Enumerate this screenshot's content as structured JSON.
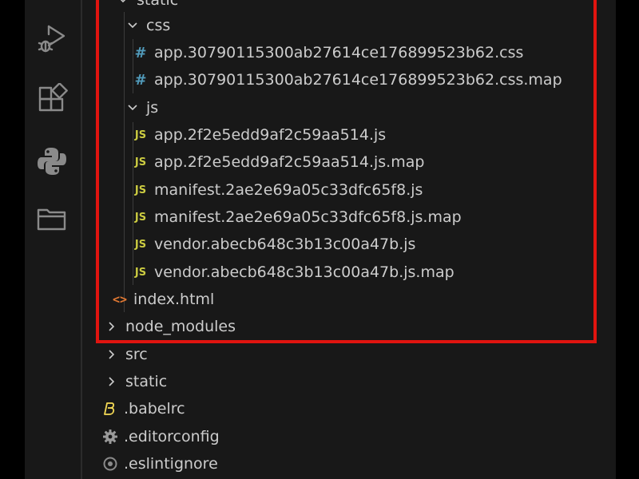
{
  "activity_bar": {
    "icons": [
      "run-debug-icon",
      "extensions-icon",
      "python-icon",
      "folder-icon"
    ]
  },
  "tree": {
    "static_folder": "static",
    "css_folder": "css",
    "css_file_1": "app.30790115300ab27614ce176899523b62.css",
    "css_file_2": "app.30790115300ab27614ce176899523b62.css.map",
    "js_folder": "js",
    "js_file_1": "app.2f2e5edd9af2c59aa514.js",
    "js_file_2": "app.2f2e5edd9af2c59aa514.js.map",
    "js_file_3": "manifest.2ae2e69a05c33dfc65f8.js",
    "js_file_4": "manifest.2ae2e69a05c33dfc65f8.js.map",
    "js_file_5": "vendor.abecb648c3b13c00a47b.js",
    "js_file_6": "vendor.abecb648c3b13c00a47b.js.map",
    "index_file": "index.html",
    "node_modules_folder": "node_modules",
    "src_folder": "src",
    "static_root_folder": "static",
    "babelrc_file": ".babelrc",
    "editorconfig_file": ".editorconfig",
    "eslintignore_file": ".eslintignore"
  },
  "icons": {
    "css_glyph": "#",
    "js_glyph": "JS",
    "html_glyph": "<>",
    "babel_glyph": "B"
  },
  "colors": {
    "highlight_border": "#e0140f",
    "css_icon": "#519aba",
    "js_icon": "#cbcb41",
    "html_icon": "#e37933",
    "babel_icon": "#f5da55",
    "background": "#181818",
    "text": "#cccccc"
  }
}
